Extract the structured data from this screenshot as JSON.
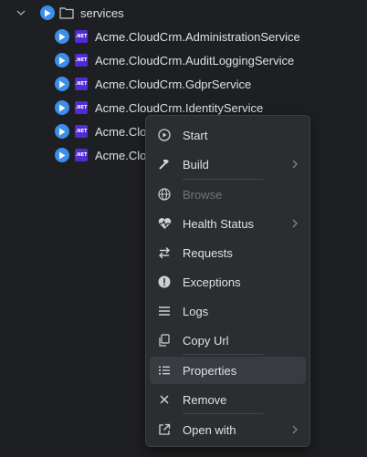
{
  "tree": {
    "folder_label": "services",
    "services": [
      {
        "label": "Acme.CloudCrm.AdministrationService"
      },
      {
        "label": "Acme.CloudCrm.AuditLoggingService"
      },
      {
        "label": "Acme.CloudCrm.GdprService"
      },
      {
        "label": "Acme.CloudCrm.IdentityService"
      },
      {
        "label": "Acme.Clo"
      },
      {
        "label": "Acme.Clo"
      }
    ],
    "net_badge": ".NET"
  },
  "context_menu": {
    "items": [
      {
        "label": "Start",
        "icon": "play-circle-icon",
        "enabled": true,
        "submenu": false
      },
      {
        "label": "Build",
        "icon": "hammer-icon",
        "enabled": true,
        "submenu": true
      },
      {
        "label": "Browse",
        "icon": "globe-icon",
        "enabled": false,
        "submenu": false
      },
      {
        "label": "Health Status",
        "icon": "heartbeat-icon",
        "enabled": true,
        "submenu": true
      },
      {
        "label": "Requests",
        "icon": "swap-arrows-icon",
        "enabled": true,
        "submenu": false
      },
      {
        "label": "Exceptions",
        "icon": "exclamation-icon",
        "enabled": true,
        "submenu": false
      },
      {
        "label": "Logs",
        "icon": "lines-icon",
        "enabled": true,
        "submenu": false
      },
      {
        "label": "Copy Url",
        "icon": "copy-icon",
        "enabled": true,
        "submenu": false
      },
      {
        "label": "Properties",
        "icon": "list-icon",
        "enabled": true,
        "submenu": false,
        "highlighted": true
      },
      {
        "label": "Remove",
        "icon": "close-icon",
        "enabled": true,
        "submenu": false
      },
      {
        "label": "Open with",
        "icon": "external-link-icon",
        "enabled": true,
        "submenu": true
      }
    ]
  },
  "colors": {
    "background": "#1e1f22",
    "play_blue": "#3b8eea",
    "net_purple": "#512bd4",
    "menu_bg": "#2b2d30",
    "menu_highlight": "#393b40"
  }
}
